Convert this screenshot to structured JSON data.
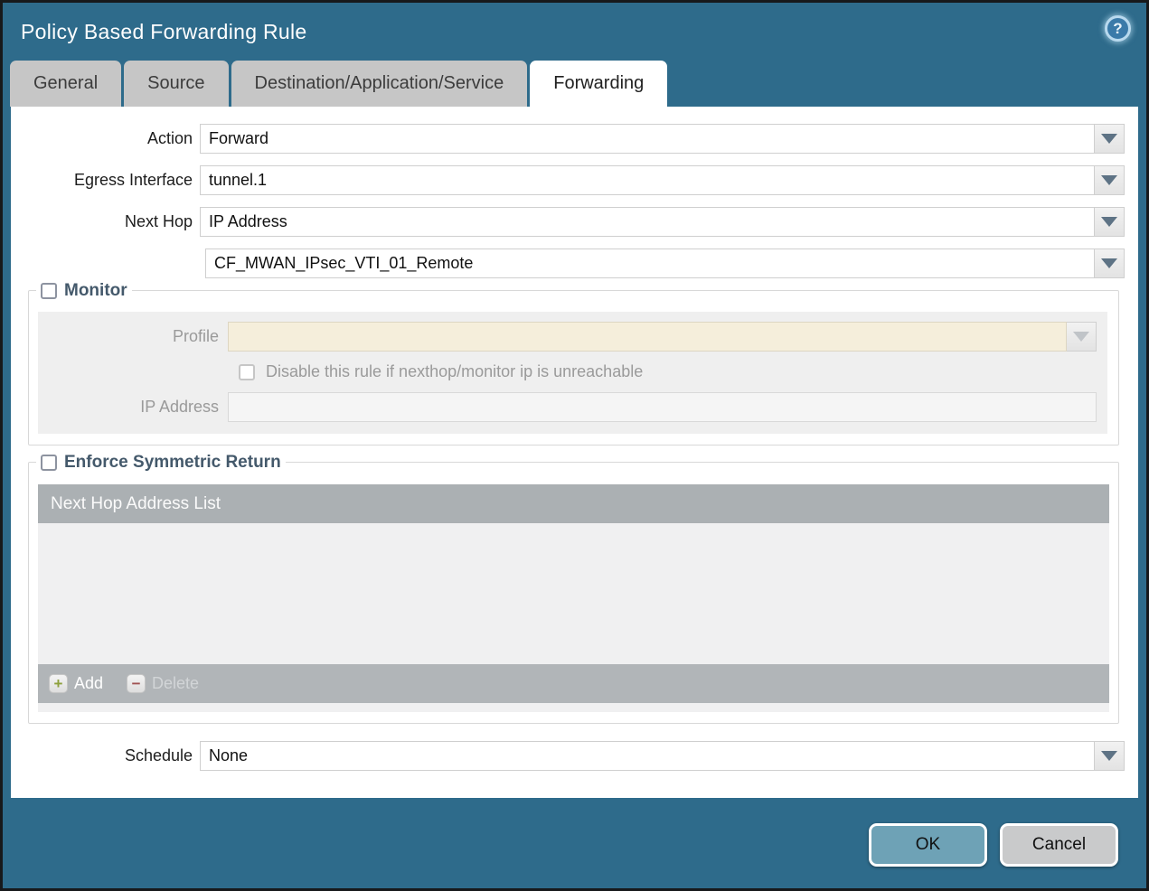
{
  "dialog": {
    "title": "Policy Based Forwarding Rule"
  },
  "help_icon": {
    "glyph": "?"
  },
  "tabs": [
    {
      "label": "General",
      "active": false
    },
    {
      "label": "Source",
      "active": false
    },
    {
      "label": "Destination/Application/Service",
      "active": false
    },
    {
      "label": "Forwarding",
      "active": true
    }
  ],
  "form": {
    "action": {
      "label": "Action",
      "value": "Forward"
    },
    "egress_interface": {
      "label": "Egress Interface",
      "value": "tunnel.1"
    },
    "next_hop": {
      "label": "Next Hop",
      "value": "IP Address"
    },
    "next_hop_address": {
      "value": "CF_MWAN_IPsec_VTI_01_Remote"
    },
    "schedule": {
      "label": "Schedule",
      "value": "None"
    }
  },
  "monitor": {
    "legend": "Monitor",
    "checked": false,
    "profile": {
      "label": "Profile",
      "value": ""
    },
    "disable_rule": {
      "label": "Disable this rule if nexthop/monitor ip is unreachable",
      "checked": false
    },
    "ip_address": {
      "label": "IP Address",
      "value": ""
    }
  },
  "enforce_symmetric_return": {
    "legend": "Enforce Symmetric Return",
    "checked": false,
    "table": {
      "header": "Next Hop Address List",
      "rows": []
    },
    "add_label": "Add",
    "delete_label": "Delete",
    "add_glyph": "+",
    "delete_glyph": "−"
  },
  "footer": {
    "ok_label": "OK",
    "cancel_label": "Cancel"
  },
  "colors": {
    "titlebar": "#2e6b8b",
    "active_tab": "#ffffff",
    "inactive_tab": "#c6c6c6",
    "legend_text": "#44596b",
    "disabled_field_bg": "#f5eedb",
    "table_header_bg": "#abb0b3",
    "table_footer_bg": "#b1b5b8",
    "ok_button": "#6ea2b6",
    "cancel_button": "#c9cacb"
  }
}
